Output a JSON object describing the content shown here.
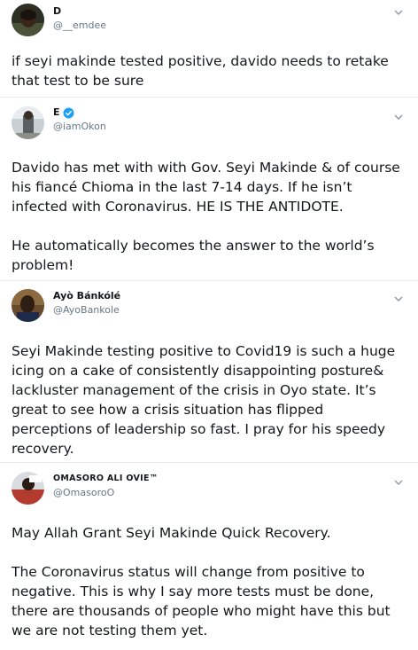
{
  "tweets": [
    {
      "display_name": "D",
      "handle": "@__emdee",
      "text": "if seyi makinde tested positive, davido needs to retake that test to be sure",
      "verified": false
    },
    {
      "display_name": "E",
      "handle": "@iamOkon",
      "text": "Davido has met with with Gov. Seyi Makinde & of course his fiancé Chioma in the last 7-14 days. If he isn’t infected with Coronavirus. HE IS THE ANTIDOTE.\n\nHe automatically becomes the answer to the world’s problem!",
      "verified": true
    },
    {
      "display_name": "Ayò Bánkólé",
      "handle": "@AyoBankole",
      "text": "Seyi Makinde testing positive to Covid19 is such a huge icing on a cake of consistently disappointing posture& lackluster management of the crisis in Oyo state. It’s great to see how a crisis situation has flipped perceptions of leadership so fast. I pray for his speedy recovery.",
      "verified": false
    },
    {
      "display_name": "OMASORO ALI OVIE™",
      "handle": "@OmasoroO",
      "text": "May Allah Grant Seyi Makinde Quick Recovery.\n\nThe Coronavirus status will change from positive to negative. This is why I say more tests must be done, there are thousands of people who might have this but we are not testing them yet.",
      "verified": false
    }
  ],
  "colors": {
    "name": "#14171a",
    "handle": "#657786",
    "divider": "#e6ecf0",
    "verified": "#1da1f2"
  }
}
